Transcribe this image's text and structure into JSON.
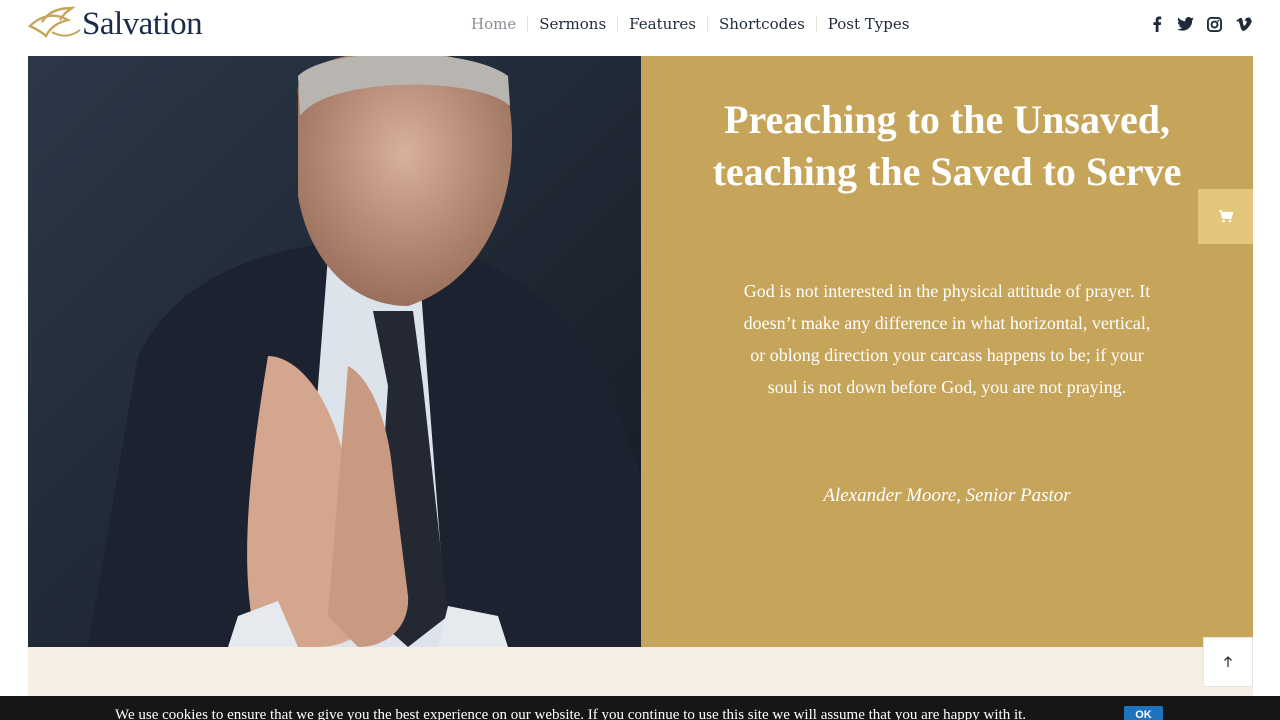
{
  "brand": {
    "name": "Salvation"
  },
  "nav": {
    "items": [
      {
        "label": "Home",
        "active": true
      },
      {
        "label": "Sermons",
        "active": false
      },
      {
        "label": "Features",
        "active": false
      },
      {
        "label": "Shortcodes",
        "active": false
      },
      {
        "label": "Post Types",
        "active": false
      }
    ]
  },
  "social": [
    "facebook-icon",
    "twitter-icon",
    "instagram-icon",
    "vimeo-icon"
  ],
  "hero": {
    "headline": "Preaching to the Unsaved, teaching the Saved to Serve",
    "quote": "God is not interested in the physical attitude of prayer. It doesn’t make any difference in what horizontal, vertical, or oblong direction your carcass happens to be; if your soul is not down before God, you are not praying.",
    "author": "Alexander Moore, Senior Pastor"
  },
  "cookie": {
    "text": "We use cookies to ensure that we give you the best experience on our website. If you continue to use this site we will assume that you are happy with it.",
    "ok_label": "OK"
  },
  "colors": {
    "accent": "#c6a55a",
    "cart_button": "#e4c57c",
    "brand_text": "#1b2b4a",
    "cream_band": "#f5efe3"
  }
}
